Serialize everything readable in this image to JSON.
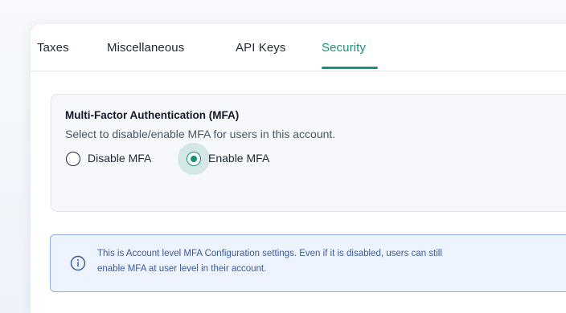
{
  "tabs": [
    {
      "label": "Taxes"
    },
    {
      "label": "Miscellaneous"
    },
    {
      "label": "API Keys"
    },
    {
      "label": "Security"
    }
  ],
  "active_tab": "Security",
  "accent_color": "#1a8f7c",
  "mfa": {
    "title": "Multi-Factor Authentication (MFA)",
    "description": "Select to disable/enable MFA for users in this account.",
    "options": [
      {
        "label": "Disable MFA",
        "selected": false
      },
      {
        "label": "Enable MFA",
        "selected": true
      }
    ]
  },
  "info": {
    "icon": "info-icon",
    "line1": "This is Account level MFA Configuration settings. Even if it is disabled, users can still",
    "line2": "enable MFA at user level in their account."
  }
}
